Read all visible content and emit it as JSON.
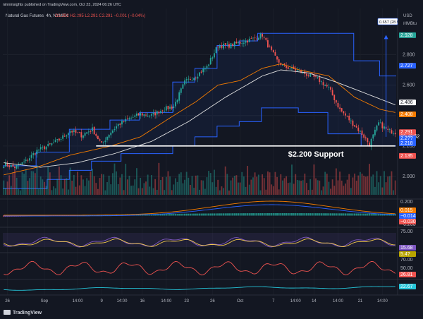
{
  "header": {
    "publisher": "ninninsights published on TradingView.com, Oct 23, 2024 06:26 UTC",
    "symbol": "Natural Gas Futures, 4h, NYMEX",
    "ohlc": "O2.292 H2.295 L2.291 C2.291 −0.001 (−0.04%)"
  },
  "footer": {
    "brand": "TradingView"
  },
  "colors": {
    "bg": "#131722",
    "up": "#26a69a",
    "down": "#ef5350",
    "blue": "#2962ff",
    "orange": "#f57c00",
    "ma": "#e0e0e0",
    "purple": "#7e57c2",
    "yellow": "#f2c94c",
    "rsiRed": "#ef5350",
    "teal": "#26c6da"
  },
  "price_scale": {
    "currency": "USD",
    "unit": "MMBtu",
    "ticks": [
      "2.800",
      "2.600",
      "2.400",
      "2.200",
      "2.000"
    ],
    "labels": [
      {
        "text": "2.928",
        "price": 2.928,
        "color": "#26a69a"
      },
      {
        "text": "2.727",
        "price": 2.727,
        "color": "#2962ff"
      },
      {
        "text": "2.486",
        "price": 2.486,
        "color": "#ffffff"
      },
      {
        "text": "2.408",
        "price": 2.408,
        "color": "#f57c00"
      },
      {
        "text": "2.291",
        "price": 2.291,
        "color": "#ef5350"
      },
      {
        "text": "03:43:52",
        "price": 2.262,
        "color": "#ef5350"
      },
      {
        "text": "2.2??",
        "price": 2.25,
        "color": "#2962ff"
      },
      {
        "text": "2.218",
        "price": 2.218,
        "color": "#2962ff"
      },
      {
        "text": "2.135",
        "price": 2.135,
        "color": "#ef5350"
      }
    ],
    "measure_label": "0.657 (28.95%)"
  },
  "annotation": {
    "text": "$2.200 Support",
    "price": 2.2
  },
  "time_axis": [
    {
      "label": "26",
      "i": 2
    },
    {
      "label": "Sep",
      "i": 22
    },
    {
      "label": "14:00",
      "i": 40
    },
    {
      "label": "9",
      "i": 53
    },
    {
      "label": "14:00",
      "i": 64
    },
    {
      "label": "16",
      "i": 75
    },
    {
      "label": "14:00",
      "i": 88
    },
    {
      "label": "23",
      "i": 99
    },
    {
      "label": "26",
      "i": 113
    },
    {
      "label": "Oct",
      "i": 128
    },
    {
      "label": "7",
      "i": 146
    },
    {
      "label": "14:00",
      "i": 158
    },
    {
      "label": "14",
      "i": 168
    },
    {
      "label": "14:00",
      "i": 181
    },
    {
      "label": "21",
      "i": 193
    },
    {
      "label": "14:00",
      "i": 205
    }
  ],
  "macd_scale": {
    "ticks": [
      "0.200",
      "−0.200"
    ],
    "labels": [
      "0.015",
      "−0.014",
      "−0.030"
    ]
  },
  "stoch_scale": {
    "ticks": [
      "75.00"
    ],
    "labels": [
      "15.68",
      "5.4?"
    ]
  },
  "rsi_scale": {
    "ticks": [
      "70.00",
      "50.00"
    ],
    "labels": [
      "26.81"
    ]
  },
  "adx_scale": {
    "ticks": [],
    "labels": [
      "22.67"
    ]
  },
  "chart_data": {
    "type": "candlestick",
    "title": "Natural Gas Futures, 4h, NYMEX",
    "ylim": [
      1.87,
      3.02
    ],
    "anchors": [
      [
        0,
        2.08
      ],
      [
        6,
        2.06
      ],
      [
        12,
        2.1
      ],
      [
        18,
        2.17
      ],
      [
        24,
        2.2
      ],
      [
        30,
        2.24
      ],
      [
        36,
        2.3
      ],
      [
        42,
        2.27
      ],
      [
        48,
        2.31
      ],
      [
        53,
        2.21
      ],
      [
        57,
        2.28
      ],
      [
        62,
        2.34
      ],
      [
        68,
        2.38
      ],
      [
        74,
        2.41
      ],
      [
        80,
        2.4
      ],
      [
        86,
        2.44
      ],
      [
        92,
        2.46
      ],
      [
        98,
        2.62
      ],
      [
        104,
        2.66
      ],
      [
        110,
        2.72
      ],
      [
        116,
        2.86
      ],
      [
        122,
        2.86
      ],
      [
        128,
        2.88
      ],
      [
        134,
        2.9
      ],
      [
        140,
        2.93
      ],
      [
        144,
        2.84
      ],
      [
        148,
        2.76
      ],
      [
        152,
        2.72
      ],
      [
        158,
        2.7
      ],
      [
        164,
        2.67
      ],
      [
        170,
        2.64
      ],
      [
        176,
        2.58
      ],
      [
        182,
        2.44
      ],
      [
        188,
        2.36
      ],
      [
        194,
        2.28
      ],
      [
        198,
        2.21
      ],
      [
        203,
        2.35
      ],
      [
        208,
        2.3
      ],
      [
        212,
        2.29
      ]
    ],
    "donchian_upper_steps": [
      [
        0,
        2.07
      ],
      [
        18,
        2.16
      ],
      [
        36,
        2.31
      ],
      [
        58,
        2.37
      ],
      [
        74,
        2.42
      ],
      [
        92,
        2.62
      ],
      [
        104,
        2.71
      ],
      [
        116,
        2.86
      ],
      [
        128,
        2.89
      ],
      [
        138,
        2.94
      ],
      [
        190,
        2.76
      ],
      [
        204,
        2.66
      ]
    ],
    "donchian_lower_steps": [
      [
        0,
        1.92
      ],
      [
        24,
        1.98
      ],
      [
        36,
        2.04
      ],
      [
        48,
        2.1
      ],
      [
        64,
        2.15
      ],
      [
        92,
        2.2
      ],
      [
        104,
        2.26
      ],
      [
        116,
        2.33
      ],
      [
        128,
        2.36
      ],
      [
        140,
        2.45
      ],
      [
        160,
        2.42
      ],
      [
        176,
        2.28
      ],
      [
        194,
        2.2
      ]
    ],
    "orange_line": [
      [
        0,
        2.01
      ],
      [
        18,
        2.06
      ],
      [
        36,
        2.14
      ],
      [
        58,
        2.2
      ],
      [
        74,
        2.26
      ],
      [
        92,
        2.4
      ],
      [
        104,
        2.49
      ],
      [
        116,
        2.6
      ],
      [
        128,
        2.63
      ],
      [
        140,
        2.71
      ],
      [
        150,
        2.74
      ],
      [
        160,
        2.7
      ],
      [
        176,
        2.66
      ],
      [
        190,
        2.52
      ],
      [
        204,
        2.44
      ],
      [
        212,
        2.42
      ]
    ],
    "ma_line": [
      [
        0,
        2.09
      ],
      [
        20,
        2.06
      ],
      [
        40,
        2.09
      ],
      [
        60,
        2.15
      ],
      [
        80,
        2.23
      ],
      [
        100,
        2.36
      ],
      [
        120,
        2.52
      ],
      [
        140,
        2.66
      ],
      [
        150,
        2.7
      ],
      [
        165,
        2.68
      ],
      [
        180,
        2.62
      ],
      [
        195,
        2.55
      ],
      [
        212,
        2.47
      ]
    ],
    "support_segment": {
      "price": 2.2,
      "from_i": 50,
      "to_i": 212
    },
    "measure": {
      "from": 2.26,
      "to": 2.93,
      "i": 207
    },
    "volume_ylim": [
      0,
      1
    ]
  }
}
